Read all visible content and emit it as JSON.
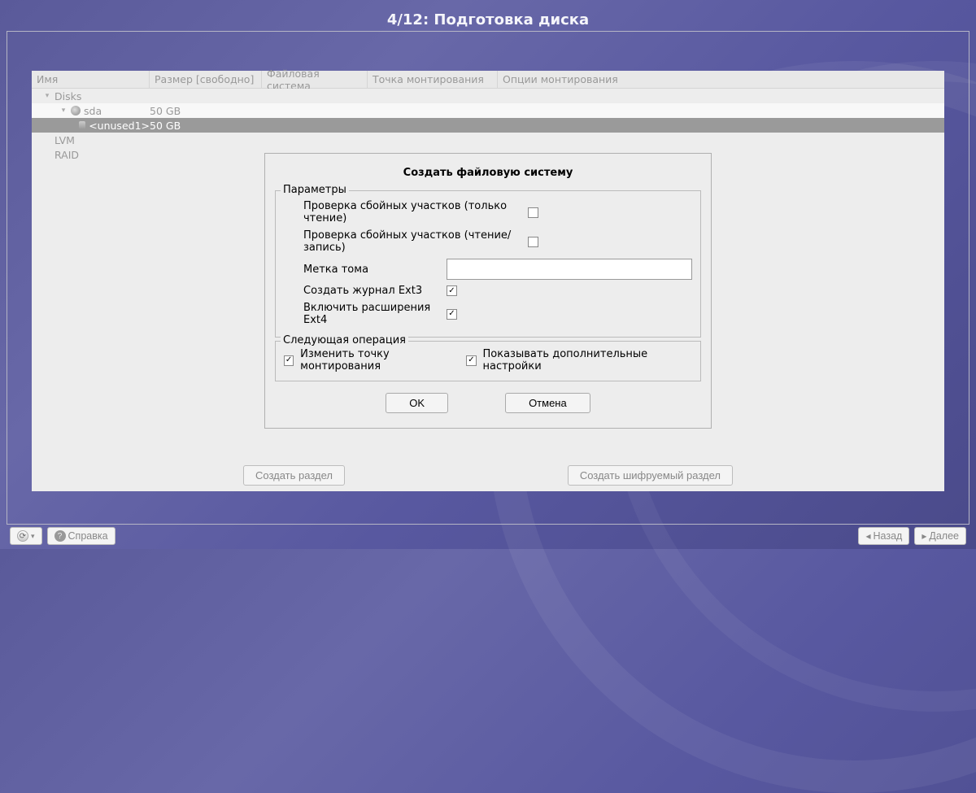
{
  "title": "4/12: Подготовка диска",
  "table": {
    "headers": [
      "Имя",
      "Размер [свободно]",
      "Файловая система",
      "Точка монтирования",
      "Опции монтирования"
    ],
    "rows": {
      "disks_label": "Disks",
      "sda_label": "sda",
      "sda_size": "50 GB",
      "unused_label": "<unused1>",
      "unused_size": "50 GB",
      "lvm_label": "LVM",
      "raid_label": "RAID"
    }
  },
  "dialog": {
    "title": "Создать файловую систему",
    "params_legend": "Параметры",
    "check_read_label": "Проверка сбойных участков (только чтение)",
    "check_read_checked": false,
    "check_rw_label": "Проверка сбойных участков (чтение/запись)",
    "check_rw_checked": false,
    "volume_label": "Метка тома",
    "volume_value": "",
    "ext3_label": "Создать журнал Ext3",
    "ext3_checked": true,
    "ext4_label": "Включить расширения Ext4",
    "ext4_checked": true,
    "next_legend": "Следующая операция",
    "opt_mount_label": "Изменить точку монтирования",
    "opt_mount_checked": true,
    "opt_extra_label": "Показывать дополнительные настройки",
    "opt_extra_checked": true,
    "ok_label": "OK",
    "cancel_label": "Отмена"
  },
  "bottom": {
    "create_partition": "Создать раздел",
    "create_encrypted": "Создать шифруемый раздел"
  },
  "footer": {
    "help_label": "Справка",
    "back_label": "Назад",
    "next_label": "Далее"
  }
}
